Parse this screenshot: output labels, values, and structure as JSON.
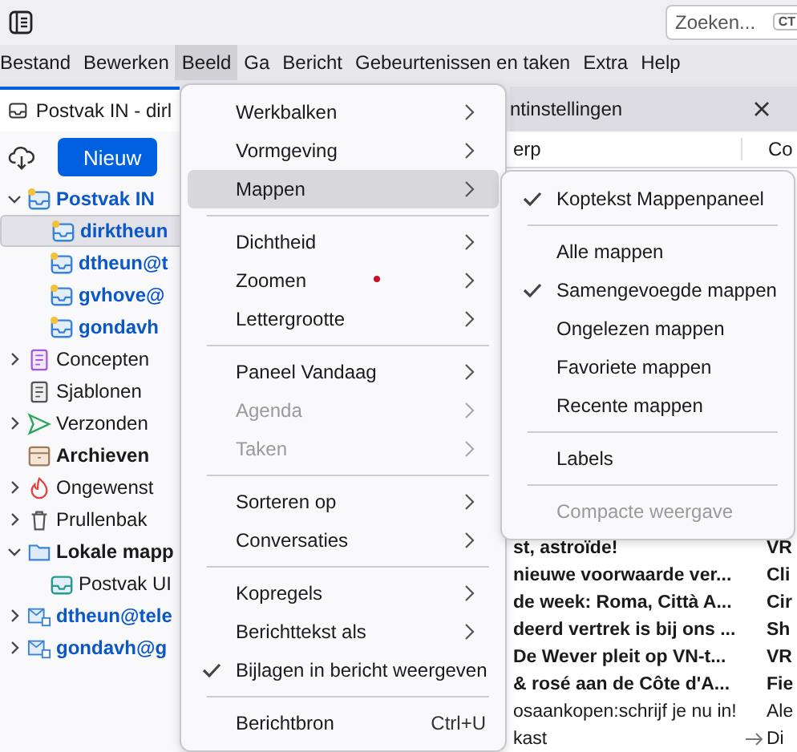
{
  "search": {
    "placeholder": "Zoeken...",
    "shortcut": "CT"
  },
  "menubar": [
    {
      "label": "Bestand",
      "selected": false
    },
    {
      "label": "Bewerken",
      "selected": false
    },
    {
      "label": "Beeld",
      "selected": true
    },
    {
      "label": "Ga",
      "selected": false
    },
    {
      "label": "Bericht",
      "selected": false
    },
    {
      "label": "Gebeurtenissen en taken",
      "selected": false
    },
    {
      "label": "Extra",
      "selected": false
    },
    {
      "label": "Help",
      "selected": false
    }
  ],
  "tabs": [
    {
      "label": "Postvak IN - dirl",
      "selected": true,
      "closable": false
    },
    {
      "label": "ntinstellingen",
      "selected": false,
      "closable": true
    }
  ],
  "toolbar": {
    "new_button": "Nieuw"
  },
  "folders": [
    {
      "label": "Postvak IN",
      "kind": "inbox",
      "emphasis": true,
      "expanded": true,
      "selected": false,
      "children": [
        {
          "label": "dirktheun",
          "kind": "inbox",
          "emphasis": true,
          "selected": true
        },
        {
          "label": "dtheun@t",
          "kind": "inbox",
          "emphasis": true,
          "selected": false
        },
        {
          "label": "gvhove@",
          "kind": "inbox",
          "emphasis": true,
          "selected": false
        },
        {
          "label": "gondavh",
          "kind": "inbox",
          "emphasis": true,
          "selected": false
        }
      ]
    },
    {
      "label": "Concepten",
      "kind": "drafts",
      "emphasis": false,
      "expanded": false,
      "selected": false
    },
    {
      "label": "Sjablonen",
      "kind": "templates",
      "emphasis": false,
      "selected": false
    },
    {
      "label": "Verzonden",
      "kind": "sent",
      "emphasis": false,
      "expanded": false,
      "selected": false
    },
    {
      "label": "Archieven",
      "kind": "archive",
      "emphasis": true,
      "selected": false
    },
    {
      "label": "Ongewenst",
      "kind": "junk",
      "emphasis": false,
      "expanded": false,
      "selected": false
    },
    {
      "label": "Prullenbak",
      "kind": "trash",
      "emphasis": false,
      "expanded": false,
      "selected": false
    },
    {
      "label": "Lokale mapp",
      "kind": "folder",
      "emphasis": true,
      "expanded": true,
      "selected": false,
      "children": [
        {
          "label": "Postvak UI",
          "kind": "outbox",
          "emphasis": false,
          "selected": false
        }
      ]
    },
    {
      "label": "dtheun@tele",
      "kind": "account",
      "emphasis": true,
      "expanded": false,
      "selected": false
    },
    {
      "label": "gondavh@g",
      "kind": "account",
      "emphasis": true,
      "expanded": false,
      "selected": false
    }
  ],
  "message_list": {
    "columns": [
      {
        "label": "erp"
      },
      {
        "label": "Co"
      }
    ],
    "rows": [
      {
        "subject": "st, astroïde!",
        "correspondent": "VR",
        "unread": true,
        "reply": false
      },
      {
        "subject": "nieuwe voorwaarde ver...",
        "correspondent": "Cli",
        "unread": true,
        "reply": false
      },
      {
        "subject": "de week: Roma, Città A...",
        "correspondent": "Cir",
        "unread": true,
        "reply": false
      },
      {
        "subject": "deerd vertrek is bij ons ...",
        "correspondent": "Sh",
        "unread": true,
        "reply": false
      },
      {
        "subject": "De Wever pleit op VN-t...",
        "correspondent": "VR",
        "unread": true,
        "reply": false
      },
      {
        "subject": "& rosé aan de Côte d'A...",
        "correspondent": "Fie",
        "unread": true,
        "reply": false
      },
      {
        "subject": "osaankopen:schrijf je nu in!",
        "correspondent": "Ale",
        "unread": false,
        "reply": false
      },
      {
        "subject": "kast",
        "correspondent": "Di",
        "unread": false,
        "reply": true
      }
    ]
  },
  "menu": [
    {
      "kind": "item",
      "label": "Werkbalken",
      "submenu": true,
      "disabled": false,
      "checked": false,
      "selected": false
    },
    {
      "kind": "item",
      "label": "Vormgeving",
      "submenu": true,
      "disabled": false,
      "checked": false,
      "selected": false
    },
    {
      "kind": "item",
      "label": "Mappen",
      "submenu": true,
      "disabled": false,
      "checked": false,
      "selected": true
    },
    {
      "kind": "separator"
    },
    {
      "kind": "item",
      "label": "Dichtheid",
      "submenu": true,
      "disabled": false,
      "checked": false,
      "selected": false
    },
    {
      "kind": "item",
      "label": "Zoomen",
      "submenu": true,
      "disabled": false,
      "checked": false,
      "selected": false,
      "dot": true
    },
    {
      "kind": "item",
      "label": "Lettergrootte",
      "submenu": true,
      "disabled": false,
      "checked": false,
      "selected": false
    },
    {
      "kind": "separator"
    },
    {
      "kind": "item",
      "label": "Paneel Vandaag",
      "submenu": true,
      "disabled": false,
      "checked": false,
      "selected": false
    },
    {
      "kind": "item",
      "label": "Agenda",
      "submenu": true,
      "disabled": true,
      "checked": false,
      "selected": false
    },
    {
      "kind": "item",
      "label": "Taken",
      "submenu": true,
      "disabled": true,
      "checked": false,
      "selected": false
    },
    {
      "kind": "separator"
    },
    {
      "kind": "item",
      "label": "Sorteren op",
      "submenu": true,
      "disabled": false,
      "checked": false,
      "selected": false
    },
    {
      "kind": "item",
      "label": "Conversaties",
      "submenu": true,
      "disabled": false,
      "checked": false,
      "selected": false
    },
    {
      "kind": "separator"
    },
    {
      "kind": "item",
      "label": "Kopregels",
      "submenu": true,
      "disabled": false,
      "checked": false,
      "selected": false
    },
    {
      "kind": "item",
      "label": "Berichttekst als",
      "submenu": true,
      "disabled": false,
      "checked": false,
      "selected": false
    },
    {
      "kind": "item",
      "label": "Bijlagen in bericht weergeven",
      "submenu": false,
      "disabled": false,
      "checked": true,
      "selected": false
    },
    {
      "kind": "separator"
    },
    {
      "kind": "item",
      "label": "Berichtbron",
      "submenu": false,
      "disabled": false,
      "checked": false,
      "selected": false,
      "shortcut": "Ctrl+U"
    }
  ],
  "submenu": [
    {
      "kind": "item",
      "label": "Koptekst Mappenpaneel",
      "disabled": false,
      "checked": true
    },
    {
      "kind": "separator"
    },
    {
      "kind": "item",
      "label": "Alle mappen",
      "disabled": false,
      "checked": false
    },
    {
      "kind": "item",
      "label": "Samengevoegde mappen",
      "disabled": false,
      "checked": true
    },
    {
      "kind": "item",
      "label": "Ongelezen mappen",
      "disabled": false,
      "checked": false
    },
    {
      "kind": "item",
      "label": "Favoriete mappen",
      "disabled": false,
      "checked": false
    },
    {
      "kind": "item",
      "label": "Recente mappen",
      "disabled": false,
      "checked": false
    },
    {
      "kind": "separator"
    },
    {
      "kind": "item",
      "label": "Labels",
      "disabled": false,
      "checked": false
    },
    {
      "kind": "separator"
    },
    {
      "kind": "item",
      "label": "Compacte weergave",
      "disabled": true,
      "checked": false
    }
  ]
}
